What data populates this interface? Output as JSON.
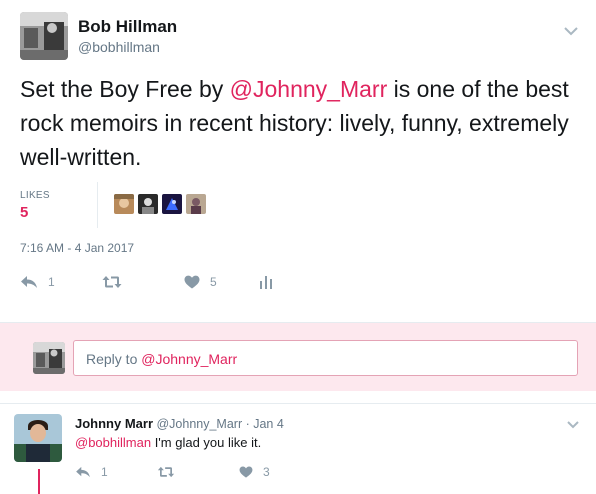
{
  "tweet": {
    "author_name": "Bob Hillman",
    "author_handle": "@bobhillman",
    "text_before": "Set the Boy Free by ",
    "text_mention": "@Johnny_Marr",
    "text_after": " is one of the best rock memoirs in recent history: lively, funny, extremely well-written.",
    "likes_label": "LIKES",
    "likes_count": "5",
    "timestamp": "7:16 AM - 4 Jan 2017",
    "actions": {
      "reply_count": "1",
      "retweet_count": "",
      "like_count": "5"
    }
  },
  "reply_composer": {
    "prefix": "Reply to ",
    "mention": "@Johnny_Marr"
  },
  "reply": {
    "author_name": "Johnny Marr",
    "author_meta": " @Johnny_Marr · Jan 4",
    "mention": "@bobhillman",
    "text": " I'm glad you like it.",
    "actions": {
      "reply_count": "1",
      "retweet_count": "",
      "like_count": "3"
    }
  },
  "icons": {
    "reply": "reply-icon",
    "retweet": "retweet-icon",
    "like": "heart-icon",
    "analytics": "analytics-icon",
    "caret": "chevron-down-icon"
  },
  "colors": {
    "accent": "#e0245e",
    "text": "#14171a",
    "muted": "#657786",
    "reply_bg": "#fde8ee"
  }
}
